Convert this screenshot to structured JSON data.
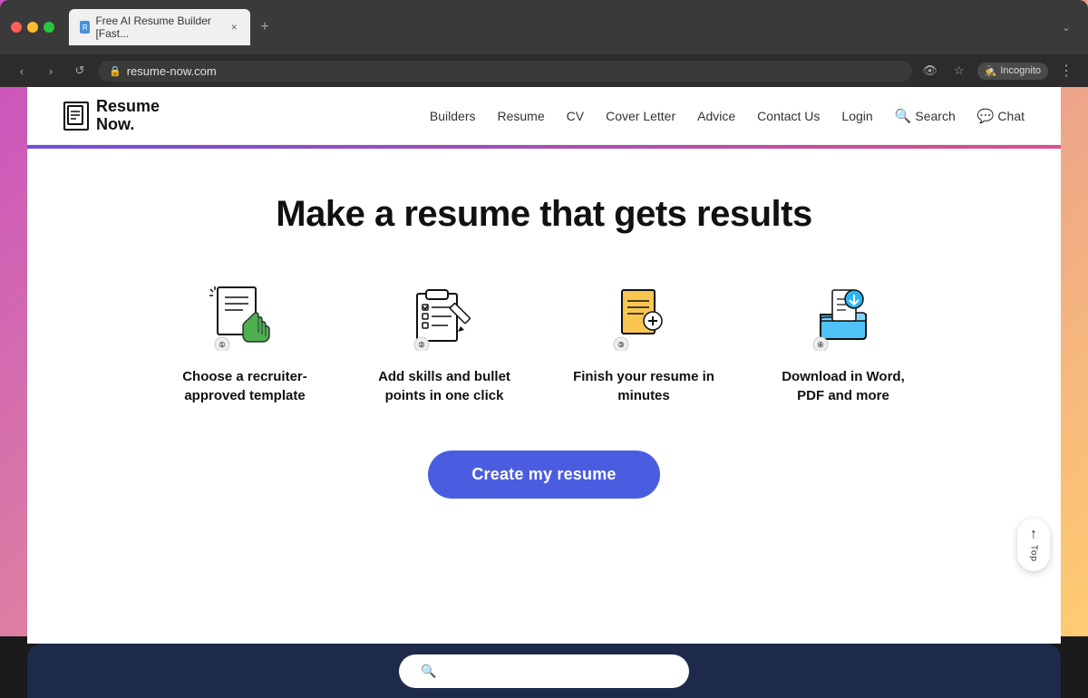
{
  "browser": {
    "tab_title": "Free AI Resume Builder [Fast...",
    "url": "resume-now.com",
    "back_btn": "‹",
    "forward_btn": "›",
    "reload_btn": "↺",
    "incognito_label": "Incognito",
    "new_tab_btn": "+",
    "more_btn": "⋮"
  },
  "nav": {
    "logo_line1": "Resume",
    "logo_line2": "Now.",
    "links": [
      "Builders",
      "Resume",
      "CV",
      "Cover Letter",
      "Advice",
      "Contact Us",
      "Login"
    ],
    "search_label": "Search",
    "chat_label": "Chat"
  },
  "hero": {
    "title": "Make a resume that gets results",
    "cta_label": "Create my resume"
  },
  "features": [
    {
      "step": "①",
      "label": "Choose a recruiter-approved template"
    },
    {
      "step": "②",
      "label": "Add skills and bullet points in one click"
    },
    {
      "step": "③",
      "label": "Finish your resume in minutes"
    },
    {
      "step": "④",
      "label": "Download in Word, PDF and more"
    }
  ],
  "scroll_top": {
    "arrow": "↑",
    "label": "Top"
  }
}
